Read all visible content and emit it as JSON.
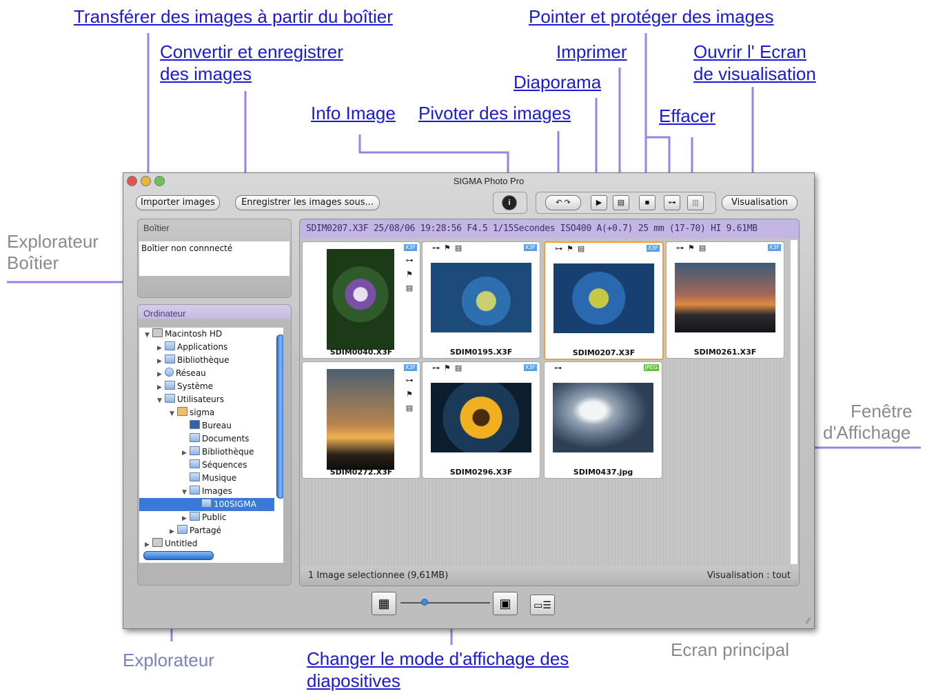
{
  "annotations": {
    "transfer": "Transférer des images à partir du boîtier",
    "convert_line1": "Convertir et enregistrer",
    "convert_line2": "des images",
    "info_image": "Info Image",
    "rotate": "Pivoter des images",
    "slideshow": "Diaporama",
    "print": "Imprimer",
    "mark_protect": "Pointer et protéger des  images",
    "open_viewer_line1": "Ouvrir l' Ecran",
    "open_viewer_line2": "de visualisation",
    "delete": "Effacer",
    "camera_explorer_line1": "Explorateur",
    "camera_explorer_line2": "Boîtier",
    "display_window_line1": "Fenêtre",
    "display_window_line2": "d'Affichage",
    "explorer": "Explorateur",
    "change_mode_line1": "Changer le mode d'affichage des",
    "change_mode_line2": "diapositives",
    "main_screen": "Ecran principal"
  },
  "window": {
    "title": "SIGMA Photo Pro",
    "buttons": {
      "import": "Importer images",
      "save_as": "Enregistrer les images sous...",
      "view": "Visualisation"
    },
    "camera_panel": {
      "title": "Boîtier",
      "status": "Boîtier non connnecté"
    },
    "computer_panel": {
      "title": "Ordinateur",
      "tree": [
        {
          "label": "Macintosh HD",
          "expanded": true
        },
        {
          "label": "Applications"
        },
        {
          "label": "Bibliothèque"
        },
        {
          "label": "Réseau"
        },
        {
          "label": "Système"
        },
        {
          "label": "Utilisateurs",
          "expanded": true
        },
        {
          "label": "sigma",
          "expanded": true
        },
        {
          "label": "Bureau"
        },
        {
          "label": "Documents"
        },
        {
          "label": "Bibliothèque"
        },
        {
          "label": "Séquences"
        },
        {
          "label": "Musique"
        },
        {
          "label": "Images",
          "expanded": true
        },
        {
          "label": "100SIGMA",
          "selected": true
        },
        {
          "label": "Public"
        },
        {
          "label": "Partagé"
        },
        {
          "label": "Untitled"
        }
      ]
    },
    "info_bar": "SDIM0207.X3F  25/08/06 19:28:56 F4.5 1/15Secondes ISO400 A(+0.7) 25 mm (17-70) HI  9.61MB",
    "thumbnails": [
      {
        "name": "SDIM0040.X3F",
        "badge": "X3F"
      },
      {
        "name": "SDIM0195.X3F",
        "badge": "X3F"
      },
      {
        "name": "SDIM0207.X3F",
        "badge": "X3F",
        "selected": true
      },
      {
        "name": "SDIM0261.X3F",
        "badge": "X3F"
      },
      {
        "name": "SDIM0272.X3F",
        "badge": "X3F"
      },
      {
        "name": "SDIM0296.X3F",
        "badge": "X3F"
      },
      {
        "name": "SDIM0437.jpg",
        "badge": "JPEG"
      }
    ],
    "status_left": "1 Image selectionnee (9,61MB)",
    "status_right": "Visualisation : tout"
  },
  "icons": {
    "info": "info-icon",
    "rotate": "rotate-icon",
    "play": "play-icon",
    "print": "print-icon",
    "mark": "mark-icon",
    "protect": "key-icon",
    "trash": "trash-icon"
  },
  "colors": {
    "annotation_link": "#1a1ad6",
    "annotation_line": "#9b80e6",
    "selection": "#3b79d8",
    "selected_thumb": "#f0a030",
    "info_bar_bg": "#c3b6e2"
  }
}
